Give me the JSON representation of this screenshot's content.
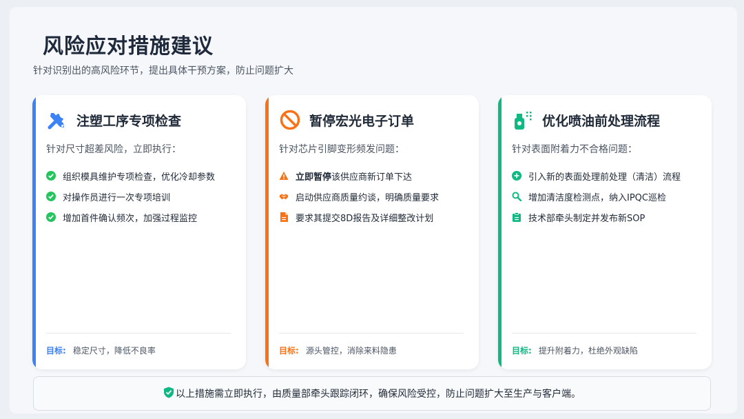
{
  "header": {
    "title": "风险应对措施建议",
    "subtitle": "针对识别出的高风险环节，提出具体干预方案，防止问题扩大"
  },
  "colors": {
    "blue": "#3b82f6",
    "orange": "#f97316",
    "green": "#10b981"
  },
  "cards": [
    {
      "title": "注塑工序专项检查",
      "icon": "tools-icon",
      "intro": "针对尺寸超差风险，立即执行：",
      "items": [
        {
          "icon": "check-circle-icon",
          "text": "组织模具维护专项检查，优化冷却参数"
        },
        {
          "icon": "check-circle-icon",
          "text": "对操作员进行一次专项培训"
        },
        {
          "icon": "check-circle-icon",
          "text": "增加首件确认频次，加强过程监控"
        }
      ],
      "goal_label": "目标:",
      "goal_text": "稳定尺寸，降低不良率"
    },
    {
      "title": "暂停宏光电子订单",
      "icon": "ban-icon",
      "intro": "针对芯片引脚变形频发问题：",
      "items": [
        {
          "icon": "warning-icon",
          "bold": "立即暂停",
          "text": "该供应商新订单下达"
        },
        {
          "icon": "handshake-icon",
          "text": "启动供应商质量约谈，明确质量要求"
        },
        {
          "icon": "file-icon",
          "text": "要求其提交8D报告及详细整改计划"
        }
      ],
      "goal_label": "目标:",
      "goal_text": "源头管控，消除来料隐患"
    },
    {
      "title": "优化喷油前处理流程",
      "icon": "spray-bottle-icon",
      "intro": "针对表面附着力不合格问题：",
      "items": [
        {
          "icon": "plus-circle-icon",
          "text": "引入新的表面处理前处理（清洁）流程"
        },
        {
          "icon": "search-icon",
          "text": "增加清洁度检测点，纳入IPQC巡检"
        },
        {
          "icon": "clipboard-icon",
          "text": "技术部牵头制定并发布新SOP"
        }
      ],
      "goal_label": "目标:",
      "goal_text": "提升附着力，杜绝外观缺陷"
    }
  ],
  "footer": {
    "icon": "shield-check-icon",
    "text": "以上措施需立即执行，由质量部牵头跟踪闭环，确保风险受控，防止问题扩大至生产与客户端。"
  }
}
